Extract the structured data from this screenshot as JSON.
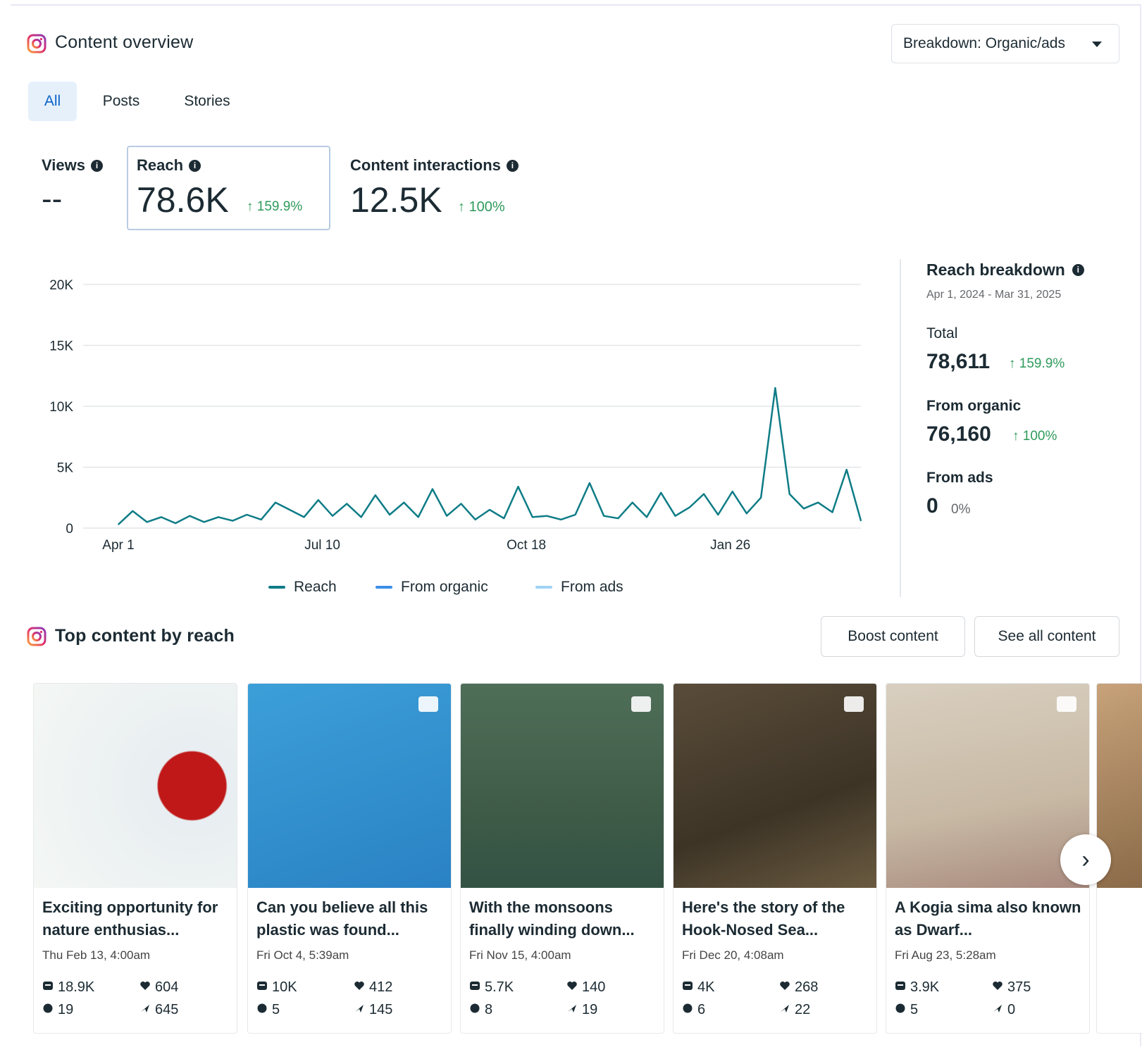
{
  "header": {
    "title": "Content overview",
    "breakdown_label": "Breakdown: Organic/ads"
  },
  "tabs": [
    {
      "label": "All",
      "active": true
    },
    {
      "label": "Posts",
      "active": false
    },
    {
      "label": "Stories",
      "active": false
    }
  ],
  "metrics": {
    "views": {
      "label": "Views",
      "value": "--"
    },
    "reach": {
      "label": "Reach",
      "value": "78.6K",
      "delta": "159.9%"
    },
    "interactions": {
      "label": "Content interactions",
      "value": "12.5K",
      "delta": "100%"
    }
  },
  "chart_data": {
    "type": "line",
    "title": "",
    "xlabel": "",
    "ylabel": "",
    "ylim": [
      0,
      20000
    ],
    "y_ticks": [
      "20K",
      "15K",
      "10K",
      "5K",
      "0"
    ],
    "x_ticks": [
      "Apr 1",
      "Jul 10",
      "Oct 18",
      "Jan 26"
    ],
    "x_range": [
      "2024-04-01",
      "2025-03-31"
    ],
    "grid": true,
    "legend_placement": "bottom",
    "series": [
      {
        "name": "Reach",
        "color": "#0e7c86",
        "points": [
          [
            "2024-04-01",
            300
          ],
          [
            "2024-04-08",
            1400
          ],
          [
            "2024-04-15",
            500
          ],
          [
            "2024-04-22",
            900
          ],
          [
            "2024-04-29",
            400
          ],
          [
            "2024-05-06",
            1000
          ],
          [
            "2024-05-13",
            500
          ],
          [
            "2024-05-20",
            900
          ],
          [
            "2024-05-27",
            600
          ],
          [
            "2024-06-03",
            1100
          ],
          [
            "2024-06-10",
            700
          ],
          [
            "2024-06-17",
            2100
          ],
          [
            "2024-06-24",
            1500
          ],
          [
            "2024-07-01",
            900
          ],
          [
            "2024-07-08",
            2300
          ],
          [
            "2024-07-15",
            1000
          ],
          [
            "2024-07-22",
            2000
          ],
          [
            "2024-07-29",
            900
          ],
          [
            "2024-08-05",
            2700
          ],
          [
            "2024-08-12",
            1100
          ],
          [
            "2024-08-19",
            2100
          ],
          [
            "2024-08-26",
            900
          ],
          [
            "2024-09-02",
            3200
          ],
          [
            "2024-09-09",
            1000
          ],
          [
            "2024-09-16",
            2000
          ],
          [
            "2024-09-23",
            700
          ],
          [
            "2024-09-30",
            1500
          ],
          [
            "2024-10-07",
            800
          ],
          [
            "2024-10-14",
            3400
          ],
          [
            "2024-10-21",
            900
          ],
          [
            "2024-10-28",
            1000
          ],
          [
            "2024-11-04",
            700
          ],
          [
            "2024-11-11",
            1100
          ],
          [
            "2024-11-18",
            3700
          ],
          [
            "2024-11-25",
            1000
          ],
          [
            "2024-12-02",
            800
          ],
          [
            "2024-12-09",
            2100
          ],
          [
            "2024-12-16",
            900
          ],
          [
            "2024-12-23",
            2900
          ],
          [
            "2024-12-30",
            1000
          ],
          [
            "2025-01-06",
            1700
          ],
          [
            "2025-01-13",
            2800
          ],
          [
            "2025-01-20",
            1100
          ],
          [
            "2025-01-27",
            3000
          ],
          [
            "2025-02-03",
            1200
          ],
          [
            "2025-02-10",
            2500
          ],
          [
            "2025-02-17",
            11500
          ],
          [
            "2025-02-24",
            2800
          ],
          [
            "2025-03-03",
            1600
          ],
          [
            "2025-03-10",
            2100
          ],
          [
            "2025-03-17",
            1300
          ],
          [
            "2025-03-24",
            4800
          ],
          [
            "2025-03-31",
            600
          ]
        ]
      },
      {
        "name": "From organic",
        "color": "#3b8ee8",
        "points": []
      },
      {
        "name": "From ads",
        "color": "#9fd3f6",
        "points": []
      }
    ]
  },
  "breakdown": {
    "title": "Reach breakdown",
    "date_range": "Apr 1, 2024 - Mar 31, 2025",
    "total_label": "Total",
    "total_value": "78,611",
    "total_delta": "159.9%",
    "organic_label": "From organic",
    "organic_value": "76,160",
    "organic_delta": "100%",
    "ads_label": "From ads",
    "ads_value": "0",
    "ads_delta": "0%"
  },
  "top_content": {
    "title": "Top content by reach",
    "boost_label": "Boost content",
    "see_all_label": "See all content",
    "cards": [
      {
        "title": "Exciting opportunity for nature enthusias...",
        "date": "Thu Feb 13, 4:00am",
        "reach": "18.9K",
        "likes": "604",
        "comments": "19",
        "shares": "645",
        "media": "none"
      },
      {
        "title": "Can you believe all this plastic was found...",
        "date": "Fri Oct 4, 5:39am",
        "reach": "10K",
        "likes": "412",
        "comments": "5",
        "shares": "145",
        "media": "carousel"
      },
      {
        "title": "With the monsoons finally winding down...",
        "date": "Fri Nov 15, 4:00am",
        "reach": "5.7K",
        "likes": "140",
        "comments": "8",
        "shares": "19",
        "media": "video"
      },
      {
        "title": "Here's the story of the Hook-Nosed Sea...",
        "date": "Fri Dec 20, 4:08am",
        "reach": "4K",
        "likes": "268",
        "comments": "6",
        "shares": "22",
        "media": "video"
      },
      {
        "title": "A Kogia sima also known as Dwarf...",
        "date": "Fri Aug 23, 5:28am",
        "reach": "3.9K",
        "likes": "375",
        "comments": "5",
        "shares": "0",
        "media": "carousel"
      }
    ]
  }
}
